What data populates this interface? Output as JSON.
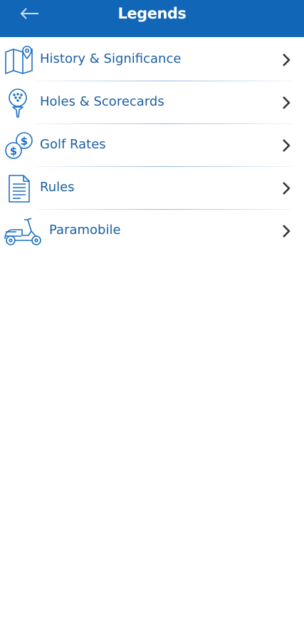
{
  "header": {
    "title": "Legends",
    "back_icon": "back-arrow-icon"
  },
  "colors": {
    "header_bg": "#1166b8",
    "item_text": "#1b5fa0",
    "icon": "#1b6fc2",
    "chevron": "#333333"
  },
  "menu": {
    "items": [
      {
        "label": "History & Significance",
        "icon": "map-pin-icon"
      },
      {
        "label": "Holes & Scorecards",
        "icon": "golf-ball-tee-icon"
      },
      {
        "label": "Golf Rates",
        "icon": "coins-icon"
      },
      {
        "label": "Rules",
        "icon": "document-icon"
      },
      {
        "label": "Paramobile",
        "icon": "scooter-icon"
      }
    ]
  }
}
